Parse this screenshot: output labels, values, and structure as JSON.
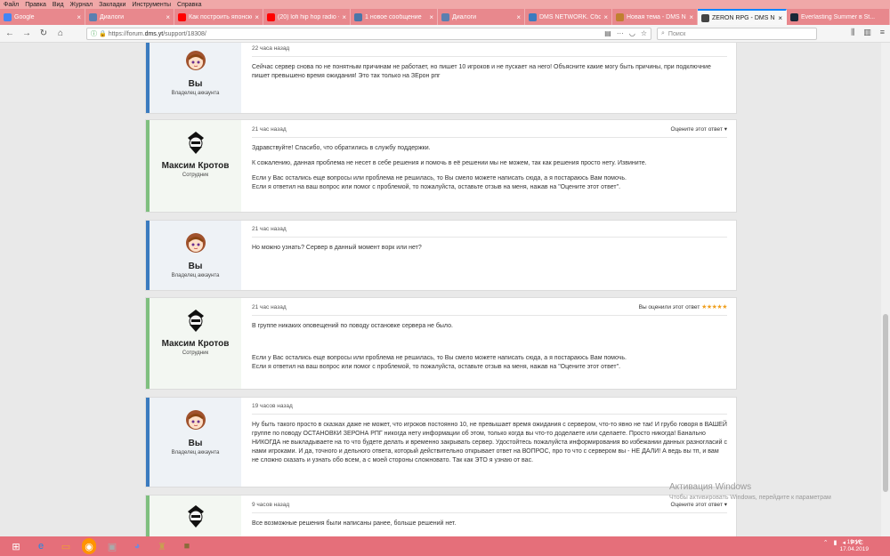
{
  "menu": [
    "Файл",
    "Правка",
    "Вид",
    "Журнал",
    "Закладки",
    "Инструменты",
    "Справка"
  ],
  "tabs": [
    {
      "title": "Google",
      "color": "#4285f4"
    },
    {
      "title": "Диалоги",
      "color": "#5b7fb0"
    },
    {
      "title": "Как построить японско...",
      "color": "#ff0000"
    },
    {
      "title": "(20) lofi hip hop radio -...",
      "color": "#ff0000"
    },
    {
      "title": "1 новое сообщение",
      "color": "#4a76a8"
    },
    {
      "title": "Диалоги",
      "color": "#5b7fb0"
    },
    {
      "title": "DMS NETWORK. Сборник...",
      "color": "#3b7bbf"
    },
    {
      "title": "Новая тема - DMS NETW...",
      "color": "#c08030"
    },
    {
      "title": "ZERON RPG - DMS NETW...",
      "color": "#444444",
      "active": true
    },
    {
      "title": "Everlasting Summer в St...",
      "color": "#1b2838"
    }
  ],
  "nav": {
    "url_prefix": "https://forum.",
    "url_host": "dms.yt",
    "url_path": "/support/18308/",
    "search_placeholder": "Поиск"
  },
  "labels": {
    "rate": "Оцените этот ответ",
    "rated": "Вы оценили этот ответ",
    "stars": "★★★★★"
  },
  "users": {
    "you": {
      "name": "Вы",
      "role": "Владелец аккаунта"
    },
    "staff": {
      "name": "Максим Кротов",
      "role": "Сотрудник"
    }
  },
  "posts": [
    {
      "time": "22 часа назад",
      "lines": [
        "Сейчас сервер снова по не понятным причинам не работает, но пишет 10 игроков и не пускает на него! Объясните какие могу быть причины, при подключние пишет превышено время ожидания! Это так только на ЗЕрон рпг"
      ]
    },
    {
      "time": "21 час назад",
      "lines": [
        "Здравствуйте! Спасибо, что обратились в службу поддержки.",
        "К сожалению, данная проблема не несет в себе решения и помочь в её решении мы не можем, так как решения просто нету. Извините.",
        "Если у Вас остались еще вопросы или проблема не решилась, то Вы смело можете написать сюда, а я постараюсь Вам помочь.",
        "Если я ответил на ваш вопрос или помог с проблемой, то пожалуйста, оставьте отзыв на меня, нажав на \"Оцените этот ответ\"."
      ]
    },
    {
      "time": "21 час назад",
      "lines": [
        "Но можно узнать? Сервер в данный момент ворк или нет?"
      ]
    },
    {
      "time": "21 час назад",
      "lines": [
        "В группе никаких оповещений по поводу остановке сервера не было.",
        "Если у Вас остались еще вопросы или проблема не решилась, то Вы смело можете написать сюда, а я постараюсь Вам помочь.",
        "Если я ответил на ваш вопрос или помог с проблемой, то пожалуйста, оставьте отзыв на меня, нажав на \"Оцените этот ответ\"."
      ]
    },
    {
      "time": "19 часов назад",
      "lines": [
        "Ну быть такого просто в сказках даже не может, что игроков постоянно 10, не превышает время ожидания с сервером, что-то явно не так! И грубо говоря в ВАШЕЙ группе по поводу ОСТАНОВКИ ЗЕРОНА РПГ никогда нету информации об этом, только когда вы что-то доделаете или сделаете. Просто никогда! Банально НИКОГДА не выкладываете на то что будете делать и временно закрывать сервер. Удостойтесь пожалуйста информирования во избежании данных разногласий с нами игроками. И да, точного и дельного ответа, который действительно открывает ответ на ВОПРОС, про то что с сервером вы - НЕ ДАЛИ! А ведь вы тп, и вам не сложно сказать и узнать обо всем, а с моей стороны сложновато. Так как ЭТО я узнаю от вас."
      ]
    },
    {
      "time": "9 часов назад",
      "lines": [
        "Все возможные решения были написаны ранее, больше решений нет."
      ]
    }
  ],
  "watermark": {
    "title": "Активация Windows",
    "subtitle": "Чтобы активировать Windows, перейдите к параметрам"
  },
  "taskbar": {
    "lang": "РУС",
    "time": "19:16",
    "date": "17.04.2019"
  },
  "colors": {
    "accent_you": "#3b7bbf",
    "accent_staff": "#7fbf7f",
    "taskbar": "#e56f7a",
    "tabstrip": "#e8888d"
  }
}
